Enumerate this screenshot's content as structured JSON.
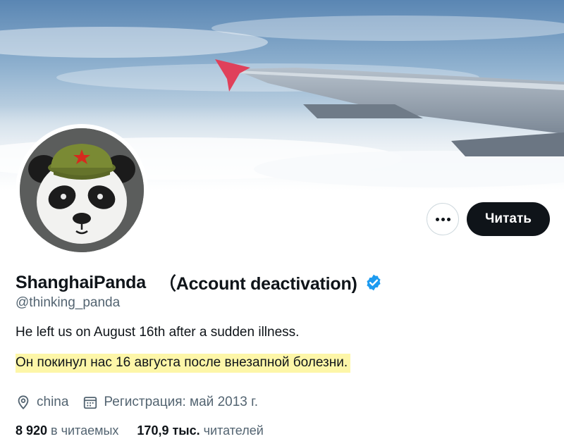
{
  "profile": {
    "display_name": "ShanghaiPanda",
    "display_note": "（Account deactivation)",
    "handle": "@thinking_panda",
    "bio_en": "He left us on August 16th after a sudden illness.",
    "bio_ru": "Он покинул нас 16 августа после внезапной болезни.",
    "verified": true,
    "location": "china",
    "joined": "Регистрация: май 2013 г."
  },
  "actions": {
    "more_icon": "more-dots-icon",
    "follow_label": "Читать"
  },
  "stats": {
    "following_count": "8 920",
    "following_label": "в читаемых",
    "followers_count": "170,9 тыс.",
    "followers_label": "читателей"
  },
  "colors": {
    "verified_blue": "#1d9bf0",
    "follow_bg": "#0f1419",
    "highlight": "#fdf6a8",
    "secondary_text": "#536471"
  }
}
